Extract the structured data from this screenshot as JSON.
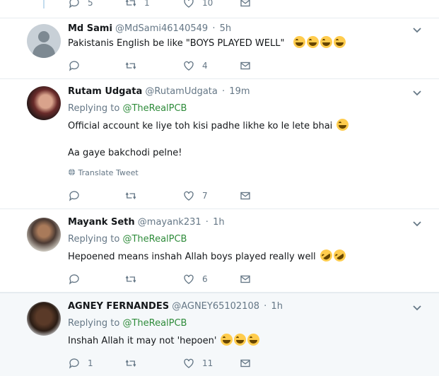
{
  "top_partial": {
    "counts": {
      "reply": "5",
      "retweet": "1",
      "like": "10"
    }
  },
  "tweets": [
    {
      "name": "Md Sami",
      "handle": "@MdSami46140549",
      "time": "5h",
      "replying_to": "",
      "lines": [
        "Pakistanis English be like \"BOYS PLAYED WELL\""
      ],
      "emoji_count": 4,
      "translate": "",
      "counts": {
        "reply": "",
        "retweet": "",
        "like": "4"
      }
    },
    {
      "name": "Rutam Udgata",
      "handle": "@RutamUdgata",
      "time": "19m",
      "replying_label": "Replying to",
      "replying_to": "@TheRealPCB",
      "lines": [
        "Official account ke liye toh kisi padhe likhe ko le lete bhai",
        "Aa gaye bakchodi pelne!"
      ],
      "translate": "Translate Tweet",
      "counts": {
        "reply": "",
        "retweet": "",
        "like": "7"
      }
    },
    {
      "name": "Mayank Seth",
      "handle": "@mayank231",
      "time": "1h",
      "replying_label": "Replying to",
      "replying_to": "@TheRealPCB",
      "lines": [
        "Hepoened means inshah Allah boys played really well"
      ],
      "translate": "",
      "counts": {
        "reply": "",
        "retweet": "",
        "like": "6"
      }
    },
    {
      "name": "AGNEY FERNANDES",
      "handle": "@AGNEY65102108",
      "time": "1h",
      "replying_label": "Replying to",
      "replying_to": "@TheRealPCB",
      "lines": [
        "Inshah Allah it may not 'hepoen'"
      ],
      "translate": "",
      "counts": {
        "reply": "1",
        "retweet": "",
        "like": "11"
      }
    }
  ],
  "icons": {
    "reply": "reply-icon",
    "retweet": "retweet-icon",
    "like": "heart-icon",
    "dm": "mail-icon",
    "more": "chevron-down-icon",
    "globe": "globe-icon"
  },
  "colors": {
    "link": "#2e8b3a",
    "muted": "#657786",
    "thread_line": "#c4dcee",
    "highlight_bg": "#f5f8fa"
  }
}
